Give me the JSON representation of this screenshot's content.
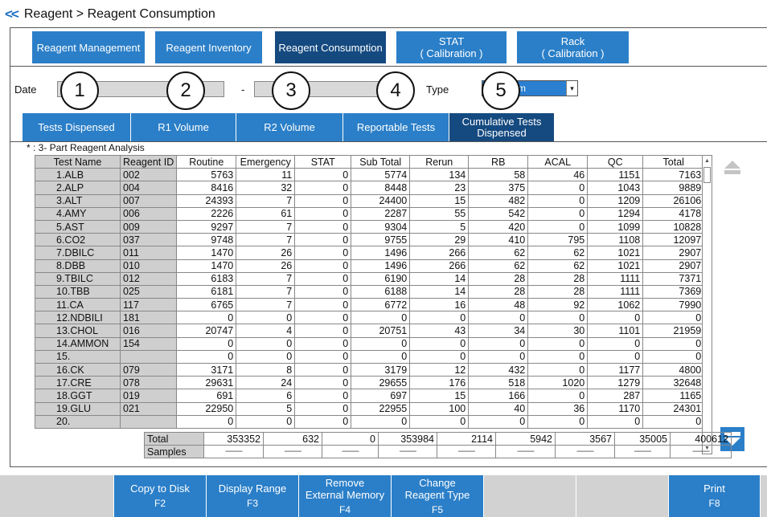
{
  "breadcrumb": {
    "back": "<<",
    "text": "Reagent > Reagent Consumption"
  },
  "tabs": [
    {
      "label": "Reagent Management",
      "active": false
    },
    {
      "label": "Reagent Inventory",
      "active": false
    },
    {
      "label": "Reagent Consumption",
      "active": true
    },
    {
      "label": "STAT\n( Calibration )",
      "active": false
    },
    {
      "label": "Rack\n( Calibration )",
      "active": false
    }
  ],
  "filter": {
    "date_label": "Date",
    "date_from": "",
    "date_sep": "-",
    "date_to": "",
    "type_label": "Type",
    "type_value": "m"
  },
  "callouts": [
    "1",
    "2",
    "3",
    "4",
    "5"
  ],
  "subtabs": [
    {
      "label": "Tests Dispensed",
      "active": false
    },
    {
      "label": "R1 Volume",
      "active": false
    },
    {
      "label": "R2 Volume",
      "active": false
    },
    {
      "label": "Reportable Tests",
      "active": false
    },
    {
      "label": "Cumulative Tests\nDispensed",
      "active": true
    }
  ],
  "note": "* : 3- Part Reagent Analysis",
  "table": {
    "columns": [
      "Test Name",
      "Reagent ID",
      "Routine",
      "Emergency",
      "STAT",
      "Sub Total",
      "Rerun",
      "RB",
      "ACAL",
      "QC",
      "Total"
    ],
    "rows": [
      [
        "1.ALB",
        "002",
        "5763",
        "11",
        "0",
        "5774",
        "134",
        "58",
        "46",
        "1151",
        "7163"
      ],
      [
        "2.ALP",
        "004",
        "8416",
        "32",
        "0",
        "8448",
        "23",
        "375",
        "0",
        "1043",
        "9889"
      ],
      [
        "3.ALT",
        "007",
        "24393",
        "7",
        "0",
        "24400",
        "15",
        "482",
        "0",
        "1209",
        "26106"
      ],
      [
        "4.AMY",
        "006",
        "2226",
        "61",
        "0",
        "2287",
        "55",
        "542",
        "0",
        "1294",
        "4178"
      ],
      [
        "5.AST",
        "009",
        "9297",
        "7",
        "0",
        "9304",
        "5",
        "420",
        "0",
        "1099",
        "10828"
      ],
      [
        "6.CO2",
        "037",
        "9748",
        "7",
        "0",
        "9755",
        "29",
        "410",
        "795",
        "1108",
        "12097"
      ],
      [
        "7.DBILC",
        "011",
        "1470",
        "26",
        "0",
        "1496",
        "266",
        "62",
        "62",
        "1021",
        "2907"
      ],
      [
        "8.DBB",
        "010",
        "1470",
        "26",
        "0",
        "1496",
        "266",
        "62",
        "62",
        "1021",
        "2907"
      ],
      [
        "9.TBILC",
        "012",
        "6183",
        "7",
        "0",
        "6190",
        "14",
        "28",
        "28",
        "1111",
        "7371"
      ],
      [
        "10.TBB",
        "025",
        "6181",
        "7",
        "0",
        "6188",
        "14",
        "28",
        "28",
        "1111",
        "7369"
      ],
      [
        "11.CA",
        "117",
        "6765",
        "7",
        "0",
        "6772",
        "16",
        "48",
        "92",
        "1062",
        "7990"
      ],
      [
        "12.NDBILI",
        "181",
        "0",
        "0",
        "0",
        "0",
        "0",
        "0",
        "0",
        "0",
        "0"
      ],
      [
        "13.CHOL",
        "016",
        "20747",
        "4",
        "0",
        "20751",
        "43",
        "34",
        "30",
        "1101",
        "21959"
      ],
      [
        "14.AMMON",
        "154",
        "0",
        "0",
        "0",
        "0",
        "0",
        "0",
        "0",
        "0",
        "0"
      ],
      [
        "15.",
        "",
        "0",
        "0",
        "0",
        "0",
        "0",
        "0",
        "0",
        "0",
        "0"
      ],
      [
        "16.CK",
        "079",
        "3171",
        "8",
        "0",
        "3179",
        "12",
        "432",
        "0",
        "1177",
        "4800"
      ],
      [
        "17.CRE",
        "078",
        "29631",
        "24",
        "0",
        "29655",
        "176",
        "518",
        "1020",
        "1279",
        "32648"
      ],
      [
        "18.GGT",
        "019",
        "691",
        "6",
        "0",
        "697",
        "15",
        "166",
        "0",
        "287",
        "1165"
      ],
      [
        "19.GLU",
        "021",
        "22950",
        "5",
        "0",
        "22955",
        "100",
        "40",
        "36",
        "1170",
        "24301"
      ],
      [
        "20.",
        "",
        "0",
        "0",
        "0",
        "0",
        "0",
        "0",
        "0",
        "0",
        "0"
      ]
    ]
  },
  "totals": {
    "total_label": "Total",
    "total_values": [
      "353352",
      "632",
      "0",
      "353984",
      "2114",
      "5942",
      "3567",
      "35005",
      "400612"
    ],
    "samples_label": "Samples",
    "samples_values": [
      "---------",
      "---------",
      "---------",
      "---------",
      "---------",
      "---------",
      "---------",
      "---------",
      "---------"
    ]
  },
  "fkeys": [
    {
      "label": "",
      "key": "",
      "enabled": false
    },
    {
      "label": "Copy to Disk",
      "key": "F2",
      "enabled": true
    },
    {
      "label": "Display Range",
      "key": "F3",
      "enabled": true
    },
    {
      "label": "Remove\nExternal Memory",
      "key": "F4",
      "enabled": true
    },
    {
      "label": "Change\nReagent Type",
      "key": "F5",
      "enabled": true
    },
    {
      "label": "",
      "key": "",
      "enabled": false
    },
    {
      "label": "",
      "key": "",
      "enabled": false
    },
    {
      "label": "Print",
      "key": "F8",
      "enabled": true
    }
  ],
  "colors": {
    "tab": "#2b7fc8",
    "tab_active": "#154a80",
    "shaded": "#cfcfcf"
  }
}
